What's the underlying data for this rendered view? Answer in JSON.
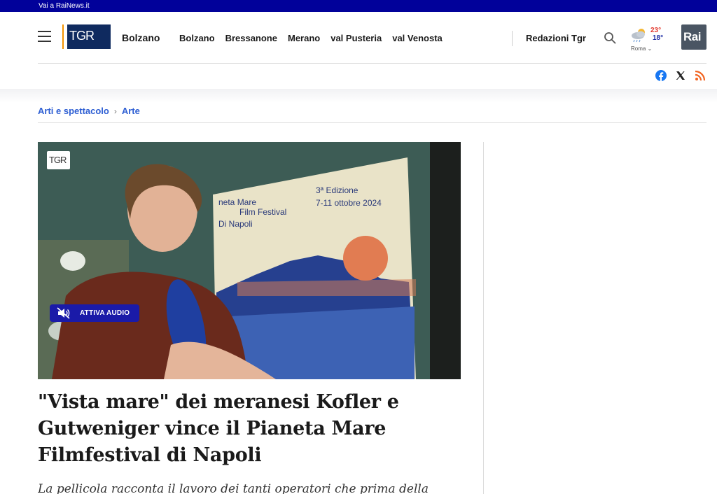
{
  "topbar": {
    "link": "Vai a RaiNews.it"
  },
  "header": {
    "logo_text": "TGR",
    "site_name": "Bolzano",
    "nav": [
      "Bolzano",
      "Bressanone",
      "Merano",
      "val Pusteria",
      "val Venosta"
    ],
    "redazioni": "Redazioni Tgr",
    "rai_logo": "Rai",
    "weather": {
      "max": "23°",
      "min": "18°",
      "city": "Roma",
      "icon": "cloud-rain-sun-icon"
    },
    "social": [
      "facebook-icon",
      "x-icon",
      "rss-icon"
    ]
  },
  "breadcrumb": {
    "section": "Arti e spettacolo",
    "subsection": "Arte"
  },
  "video": {
    "watermark": "TGR",
    "audio_button": "ATTIVA AUDIO",
    "poster_lines": [
      "neta Mare",
      "Film Festival",
      "Di Napoli"
    ],
    "poster_edition": "3ª Edizione",
    "poster_dates": "7-11 ottobre 2024"
  },
  "article": {
    "headline": "\"Vista mare\" dei meranesi Kofler e Gutweniger vince il Pianeta Mare Filmfestival di Napoli",
    "subhead": "La pellicola racconta il lavoro dei tanti operatori che prima della"
  },
  "colors": {
    "topbar": "#01019a",
    "link": "#2d5ed3",
    "audio_button": "#1a1aa8",
    "rai_logo": "#4a5563"
  }
}
